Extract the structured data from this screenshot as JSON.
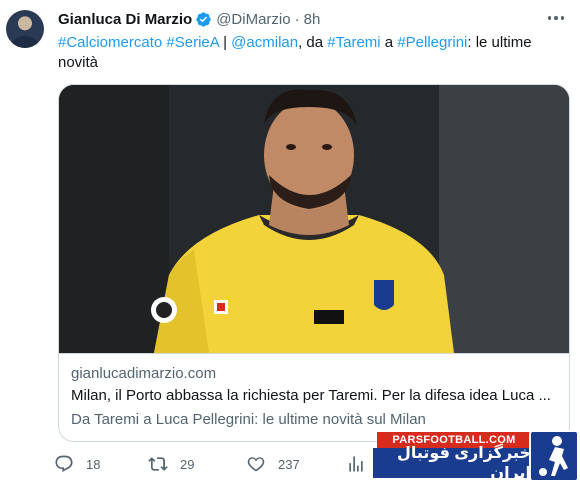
{
  "tweet": {
    "author_name": "Gianluca Di Marzio",
    "handle": "@DiMarzio",
    "separator": "·",
    "time": "8h",
    "text_parts": {
      "tag1": "#Calciomercato",
      "tag2": "#SerieA",
      "pipe": " | ",
      "mention": "@acmilan",
      "mid1": ", da ",
      "tag3": "#Taremi",
      "mid2": " a ",
      "tag4": "#Pellegrini",
      "tail": ": le ultime novità"
    }
  },
  "card": {
    "domain": "gianlucadimarzio.com",
    "title": "Milan, il Porto abbassa la richiesta per Taremi. Per la difesa idea Luca ...",
    "description": "Da Taremi a Luca Pellegrini: le ultime novità sul Milan"
  },
  "actions": {
    "replies": "18",
    "retweets": "29",
    "likes": "237"
  },
  "watermark": {
    "site": "PARSFOOTBALL.COM",
    "slogan": "خبرگزاری فوتبال ایران"
  },
  "colors": {
    "link": "#1d9bf0",
    "verified": "#1d9bf0",
    "muted": "#536471",
    "border": "#cfd9de",
    "jersey": "#f2d33a",
    "ad_blue": "#1a3c8f",
    "ad_red": "#d62c1e"
  },
  "icons": [
    "more-icon",
    "verified-badge-icon",
    "reply-icon",
    "retweet-icon",
    "like-icon",
    "views-icon"
  ]
}
